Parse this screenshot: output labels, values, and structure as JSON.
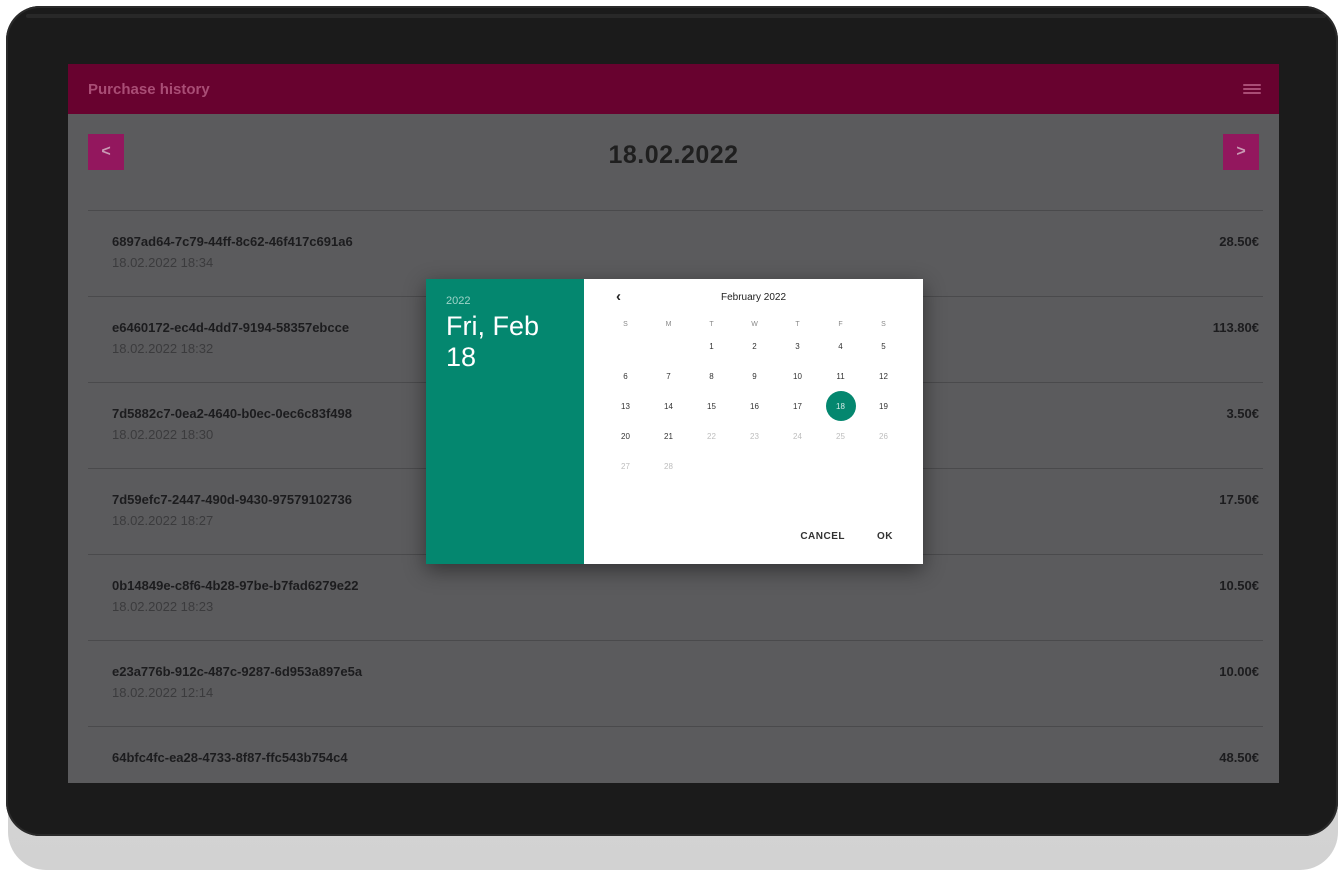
{
  "app": {
    "title": "Purchase history"
  },
  "date_nav": {
    "prev_label": "<",
    "next_label": ">",
    "current_date": "18.02.2022"
  },
  "purchases": [
    {
      "id": "6897ad64-7c79-44ff-8c62-46f417c691a6",
      "time": "18.02.2022 18:34",
      "amount": "28.50€"
    },
    {
      "id": "e6460172-ec4d-4dd7-9194-58357ebcce",
      "time": "18.02.2022 18:32",
      "amount": "113.80€"
    },
    {
      "id": "7d5882c7-0ea2-4640-b0ec-0ec6c83f498",
      "time": "18.02.2022 18:30",
      "amount": "3.50€"
    },
    {
      "id": "7d59efc7-2447-490d-9430-97579102736",
      "time": "18.02.2022 18:27",
      "amount": "17.50€"
    },
    {
      "id": "0b14849e-c8f6-4b28-97be-b7fad6279e22",
      "time": "18.02.2022 18:23",
      "amount": "10.50€"
    },
    {
      "id": "e23a776b-912c-487c-9287-6d953a897e5a",
      "time": "18.02.2022 12:14",
      "amount": "10.00€"
    },
    {
      "id": "64bfc4fc-ea28-4733-8f87-ffc543b754c4",
      "time": "",
      "amount": "48.50€"
    }
  ],
  "date_picker": {
    "year": "2022",
    "selected_label": "Fri, Feb 18",
    "month_label": "February 2022",
    "prev_month_icon": "chevron-left-icon",
    "weekdays": [
      "S",
      "M",
      "T",
      "W",
      "T",
      "F",
      "S"
    ],
    "weeks": [
      [
        "",
        "",
        "1",
        "2",
        "3",
        "4",
        "5"
      ],
      [
        "6",
        "7",
        "8",
        "9",
        "10",
        "11",
        "12"
      ],
      [
        "13",
        "14",
        "15",
        "16",
        "17",
        "18",
        "19"
      ],
      [
        "20",
        "21",
        "22",
        "23",
        "24",
        "25",
        "26"
      ],
      [
        "27",
        "28",
        "",
        "",
        "",
        "",
        ""
      ]
    ],
    "selected_day": "18",
    "disabled_after": "21",
    "cancel_label": "CANCEL",
    "ok_label": "OK"
  },
  "colors": {
    "app_bar": "#68022f",
    "nav_button": "#93175e",
    "screen_dim": "#5b5b5d",
    "picker_accent": "#04876f"
  }
}
